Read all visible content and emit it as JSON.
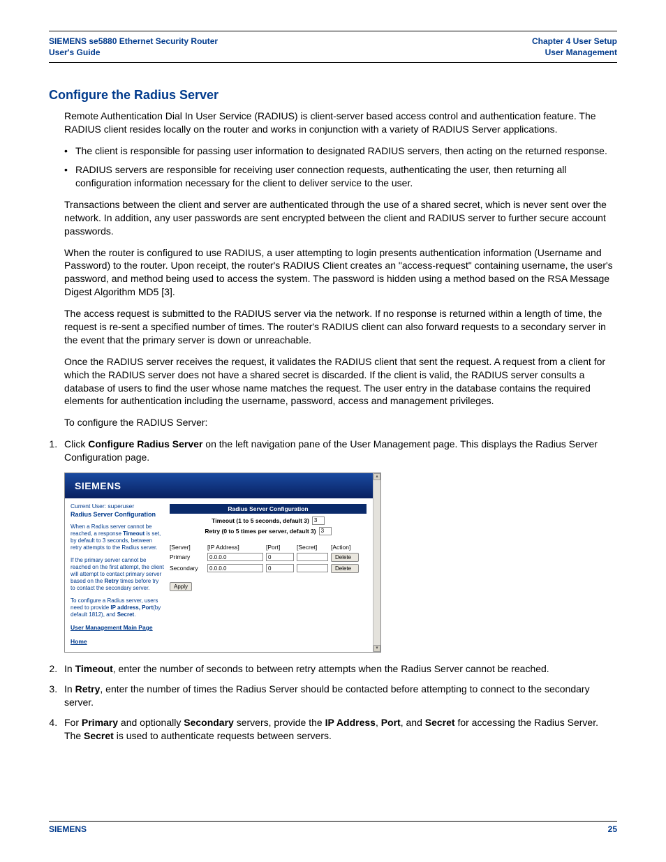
{
  "header": {
    "left_line1": "SIEMENS se5880 Ethernet Security Router",
    "left_line2": "User's Guide",
    "right_line1": "Chapter 4  User Setup",
    "right_line2": "User Management"
  },
  "section_title": "Configure the Radius Server",
  "para_intro": "Remote Authentication Dial In User Service (RADIUS) is client-server based access control and authentication feature. The RADIUS client resides locally on the router and works in conjunction with a variety of RADIUS Server applications.",
  "bullets": [
    "The client is responsible for passing user information to designated RADIUS servers, then acting on the returned response.",
    "RADIUS servers are responsible for receiving user connection requests, authenticating the user, then returning all configuration information necessary for the client to deliver service to the user."
  ],
  "para_trans": "Transactions between the client and server are authenticated through the use of a shared secret, which is never sent over the network. In addition, any user passwords are sent encrypted between the client and RADIUS server to further secure account passwords.",
  "para_when": "When the router is configured to use RADIUS, a user attempting to login presents authentication information (Username and Password) to the router. Upon receipt, the router's RADIUS Client creates an \"access-request\" containing username, the user's password, and method being used to access the system. The password is hidden using a method based on the RSA Message Digest Algorithm MD5 [3].",
  "para_access": "The access request is submitted to the RADIUS server via the network. If no response is returned within a length of time, the request is re-sent a specified number of times. The router's RADIUS client can also forward requests to a secondary server in the event that the primary server is down or unreachable.",
  "para_once": "Once the RADIUS server receives the request, it validates the RADIUS client that sent the request. A request from a client for which the RADIUS server does not have a shared secret is discarded. If the client is valid, the RADIUS server consults a database of users to find the user whose name matches the request. The user entry in the database contains the required elements for authentication including the username, password, access and management privileges.",
  "para_toconf": "To configure the RADIUS Server:",
  "step1_pre": "Click ",
  "step1_bold": "Configure Radius Server",
  "step1_post": " on the left navigation pane of the User Management page. This displays the Radius Server Configuration page.",
  "shot": {
    "logo": "SIEMENS",
    "current_user_label": "Current User: superuser",
    "page_title": "Radius Server Configuration",
    "left_block1_a": "When a Radius server cannot be reached, a response ",
    "left_block1_b": "Timeout",
    "left_block1_c": " is set, by default to 3 seconds, between retry attempts to the Radius server.",
    "left_block2_a": "If the primary server cannot be reached on the first attempt, the client will attempt to contact primary server based on the ",
    "left_block2_b": "Retry",
    "left_block2_c": " times before try to contact the secondary server.",
    "left_block3_a": "To configure a Radius server, users need to provide ",
    "left_block3_b": "IP address, Port",
    "left_block3_c": "(by default 1812), and ",
    "left_block3_d": "Secret",
    "left_block3_e": ".",
    "link1": "User Management Main Page",
    "link2": "Home",
    "cfg_title": "Radius Server Configuration",
    "timeout_label": "Timeout (1 to 5 seconds, default 3)",
    "timeout_value": "3",
    "retry_label": "Retry (0 to 5 times per server, default 3)",
    "retry_value": "3",
    "cols": {
      "server": "[Server]",
      "ip": "[IP Address]",
      "port": "[Port]",
      "secret": "[Secret]",
      "action": "[Action]"
    },
    "rows": [
      {
        "server": "Primary",
        "ip": "0.0.0.0",
        "port": "0",
        "secret": "",
        "action": "Delete"
      },
      {
        "server": "Secondary",
        "ip": "0.0.0.0",
        "port": "0",
        "secret": "",
        "action": "Delete"
      }
    ],
    "apply": "Apply"
  },
  "step2_a": "In ",
  "step2_b": "Timeout",
  "step2_c": ", enter the number of seconds to between retry attempts when the Radius Server cannot be reached.",
  "step3_a": "In ",
  "step3_b": "Retry",
  "step3_c": ", enter the number of times the Radius Server should be contacted before attempting to connect to the secondary server.",
  "step4_a": "For ",
  "step4_b": "Primary",
  "step4_c": " and optionally ",
  "step4_d": "Secondary",
  "step4_e": " servers, provide the ",
  "step4_f": "IP Address",
  "step4_g": ", ",
  "step4_h": "Port",
  "step4_i": ", and ",
  "step4_j": "Secret",
  "step4_k": " for accessing the Radius Server. The ",
  "step4_l": "Secret",
  "step4_m": " is used to authenticate requests between servers.",
  "footer": {
    "left": "SIEMENS",
    "right": "25"
  }
}
